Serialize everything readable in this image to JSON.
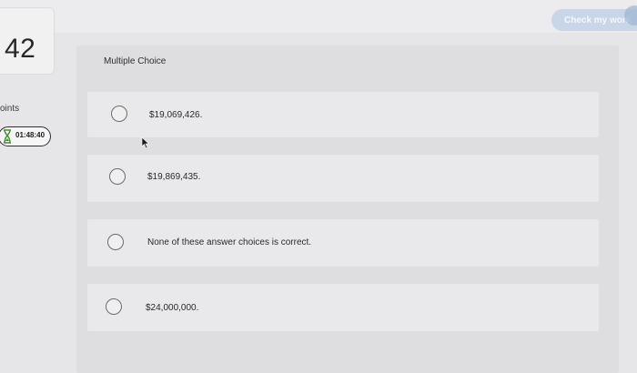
{
  "header": {
    "check_button_label": "Check my work"
  },
  "sidebar": {
    "question_number": "42",
    "points_label": "oints",
    "timer": "01:48:40"
  },
  "question": {
    "type_label": "Multiple Choice",
    "options": [
      {
        "label": "$19,069,426."
      },
      {
        "label": "$19,869,435."
      },
      {
        "label": "None of these answer choices is correct."
      },
      {
        "label": "$24,000,000."
      }
    ]
  }
}
